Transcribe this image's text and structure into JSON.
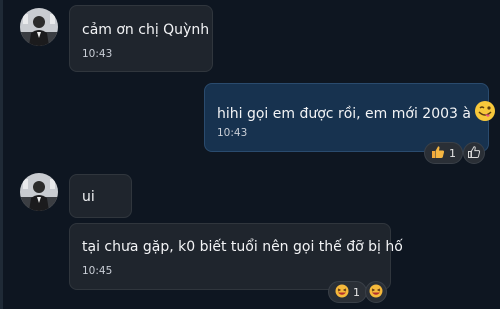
{
  "messages": [
    {
      "direction": "incoming",
      "text": "cảm ơn chị Quỳnh",
      "time": "10:43"
    },
    {
      "direction": "outgoing",
      "text": "hihi gọi em được rồi, em mới 2003 à",
      "time": "10:43",
      "emoji": "winking-face-with-tongue",
      "reactions": [
        {
          "emoji": "thumbs-up",
          "count": "1"
        }
      ],
      "add_reaction_icon": "thumbs-up-outline"
    },
    {
      "direction": "incoming",
      "text": "ui"
    },
    {
      "direction": "incoming",
      "text": "tại chưa gặp, k0 biết tuổi nên gọi thế đỡ bị hố",
      "time": "10:45",
      "reactions": [
        {
          "emoji": "laughing-face",
          "count": "1"
        }
      ],
      "add_reaction_icon": "laughing-face"
    }
  ],
  "colors": {
    "background": "#0e1621",
    "incoming_bubble": "#1f252d",
    "outgoing_bubble": "#17324f",
    "text": "#f3f4f6",
    "time": "#c9ced6"
  }
}
